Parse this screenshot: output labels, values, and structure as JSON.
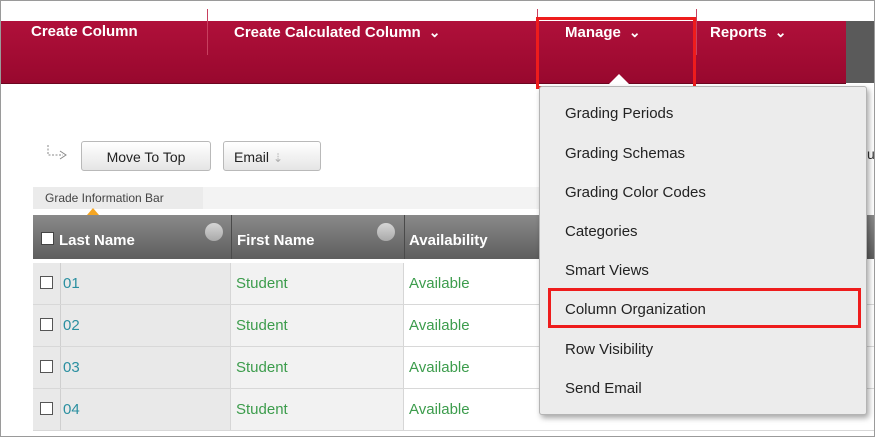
{
  "action_bar": {
    "create_column": "Create Column",
    "create_calculated_column": "Create Calculated Column",
    "manage": "Manage",
    "reports": "Reports",
    "chevron": "⌄",
    "colors": {
      "bar": "#a80c35",
      "highlight": "#ee1c1c"
    }
  },
  "toolbar": {
    "move_to_top": "Move To Top",
    "email": "Email",
    "cut_off_text": "u",
    "info_bar": "Grade Information Bar"
  },
  "grid": {
    "columns": [
      "Last Name",
      "First Name",
      "Availability"
    ],
    "rows": [
      {
        "last_name": "01",
        "first_name": "Student",
        "availability": "Available"
      },
      {
        "last_name": "02",
        "first_name": "Student",
        "availability": "Available"
      },
      {
        "last_name": "03",
        "first_name": "Student",
        "availability": "Available"
      },
      {
        "last_name": "04",
        "first_name": "Student",
        "availability": "Available"
      }
    ]
  },
  "manage_menu": {
    "items": [
      "Grading Periods",
      "Grading Schemas",
      "Grading Color Codes",
      "Categories",
      "Smart Views",
      "Column Organization",
      "Row Visibility",
      "Send Email"
    ],
    "highlighted_item": "Column Organization"
  }
}
